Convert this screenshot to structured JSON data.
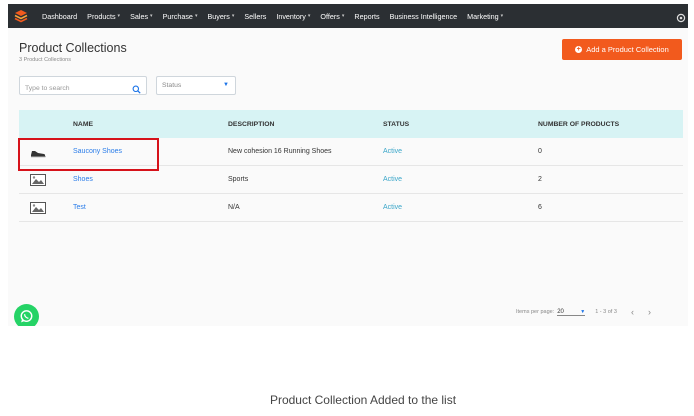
{
  "nav": {
    "items": [
      {
        "label": "Dashboard",
        "dropdown": false
      },
      {
        "label": "Products",
        "dropdown": true
      },
      {
        "label": "Sales",
        "dropdown": true
      },
      {
        "label": "Purchase",
        "dropdown": true
      },
      {
        "label": "Buyers",
        "dropdown": true
      },
      {
        "label": "Sellers",
        "dropdown": false
      },
      {
        "label": "Inventory",
        "dropdown": true
      },
      {
        "label": "Offers",
        "dropdown": true
      },
      {
        "label": "Reports",
        "dropdown": false
      },
      {
        "label": "Business Intelligence",
        "dropdown": false
      },
      {
        "label": "Marketing",
        "dropdown": true
      }
    ]
  },
  "header": {
    "title": "Product Collections",
    "subtitle": "3 Product Collections",
    "add_button": "Add a Product Collection"
  },
  "filters": {
    "search_placeholder": "Type to search",
    "status_placeholder": "Status"
  },
  "table": {
    "columns": [
      "NAME",
      "DESCRIPTION",
      "STATUS",
      "NUMBER OF PRODUCTS"
    ],
    "rows": [
      {
        "thumb": "shoe",
        "name": "Saucony Shoes",
        "description": "New cohesion 16 Running Shoes",
        "status": "Active",
        "count": "0"
      },
      {
        "thumb": "image-placeholder",
        "name": "Shoes",
        "description": "Sports",
        "status": "Active",
        "count": "2"
      },
      {
        "thumb": "image-placeholder",
        "name": "Test",
        "description": "N/A",
        "status": "Active",
        "count": "6"
      }
    ]
  },
  "pagination": {
    "items_per_page_label": "Items per page:",
    "items_per_page": "20",
    "range": "1 - 3 of 3"
  },
  "caption": "Product Collection Added to the list",
  "colors": {
    "nav_bg": "#2b2f33",
    "accent": "#f25a1d",
    "header_row": "#d7f3f4",
    "link": "#2b7de9",
    "highlight": "#d6121a"
  }
}
